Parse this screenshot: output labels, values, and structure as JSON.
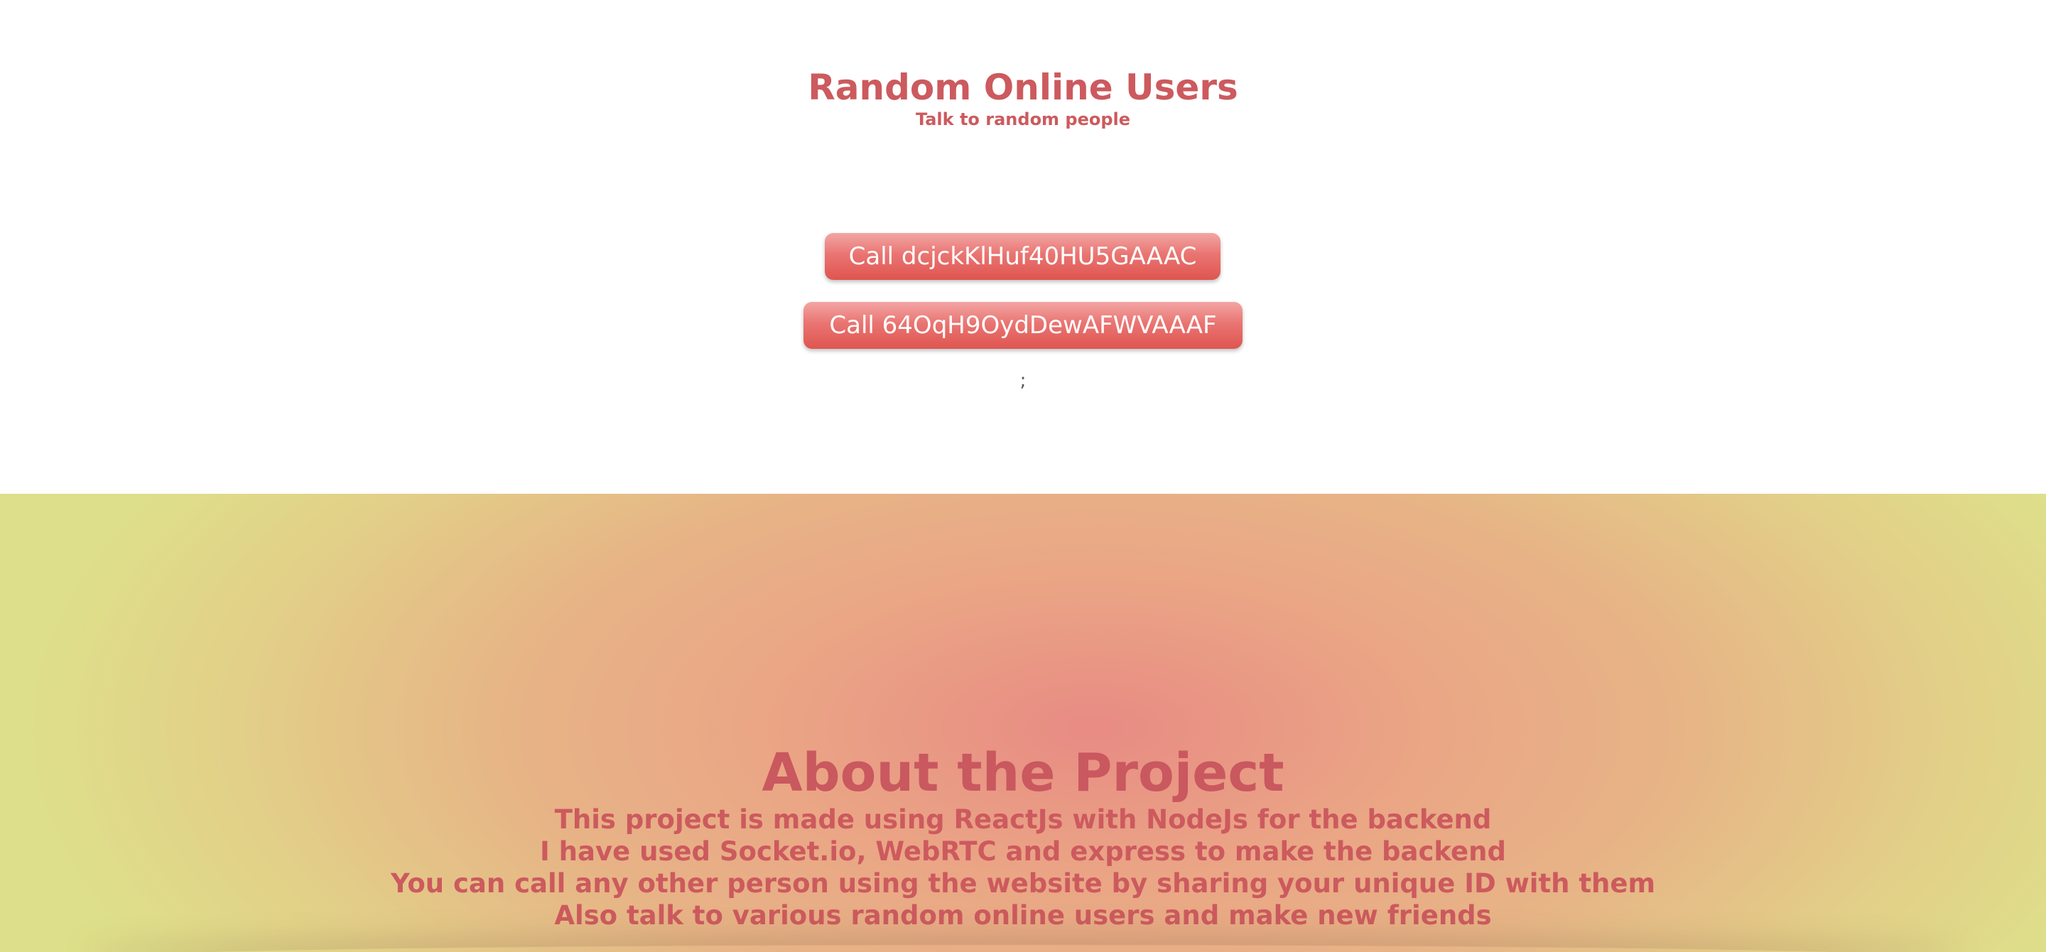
{
  "header": {
    "title": "Random Online Users",
    "subtitle": "Talk to random people"
  },
  "users": [
    {
      "call_label": "Call dcjckKlHuf40HU5GAAAC"
    },
    {
      "call_label": "Call 64OqH9OydDewAFWVAAAF"
    }
  ],
  "stray_text": ";",
  "about": {
    "title": "About the Project",
    "lines": [
      "This project is made using ReactJs with NodeJs for the backend",
      "I have used Socket.io, WebRTC and express to make the backend",
      "You can call any other person using the website by sharing your unique ID with them",
      "Also talk to various random online users and make new friends"
    ]
  },
  "colors": {
    "accent": "#cc5a5e",
    "button_top": "#f2a6a4",
    "button_bottom": "#df5550",
    "about_center": "#e88b84",
    "about_edge": "#dedf8a"
  }
}
